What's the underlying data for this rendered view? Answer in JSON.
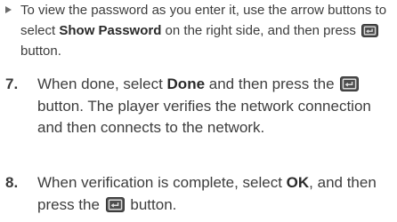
{
  "bullet": {
    "part1": "To view the password as you enter it, use the arrow buttons to select ",
    "bold": "Show Password",
    "part2": " on the right side, and then press ",
    "part3": " button."
  },
  "step7": {
    "number": "7.",
    "part1": "When done, select ",
    "bold": "Done",
    "part2": " and then press the ",
    "part3": " button. The player verifies the network connection and then connects to the network."
  },
  "step8": {
    "number": "8.",
    "part1": "When verification is complete, select ",
    "bold": "OK",
    "part2": ", and then press the ",
    "part3": " button."
  },
  "icons": {
    "enter_button": "enter-button-icon"
  }
}
